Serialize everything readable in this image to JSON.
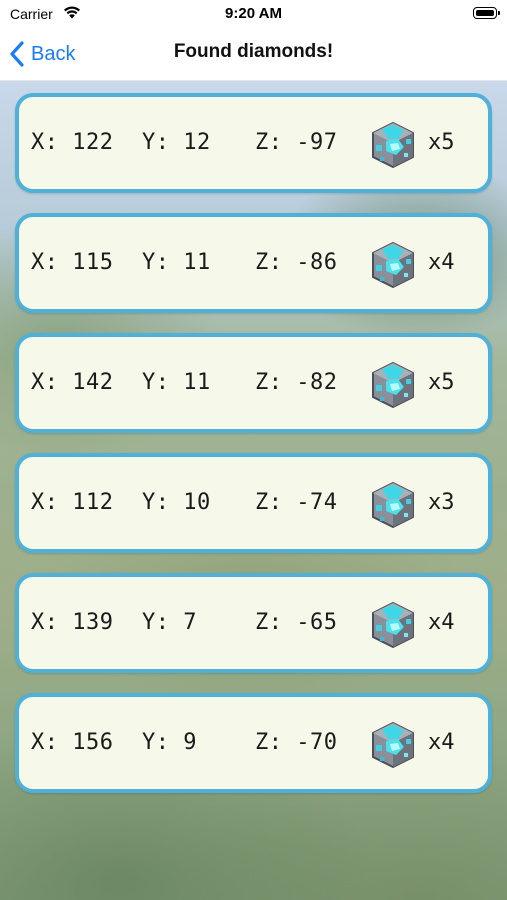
{
  "status_bar": {
    "carrier": "Carrier",
    "time": "9:20 AM"
  },
  "nav": {
    "back_label": "Back",
    "title": "Found diamonds!"
  },
  "icons": {
    "back": "chevron-left-icon",
    "wifi": "wifi-icon",
    "battery": "battery-icon",
    "ore": "diamond-ore-icon"
  },
  "colors": {
    "accent": "#1a7cf5",
    "card_border": "#4fb0d8",
    "card_background": "#f6f9ea"
  },
  "finds": [
    {
      "x": "X: 122",
      "y": "Y: 12",
      "z": "Z: -97",
      "count": "x5"
    },
    {
      "x": "X: 115",
      "y": "Y: 11",
      "z": "Z: -86",
      "count": "x4"
    },
    {
      "x": "X: 142",
      "y": "Y: 11",
      "z": "Z: -82",
      "count": "x5"
    },
    {
      "x": "X: 112",
      "y": "Y: 10",
      "z": "Z: -74",
      "count": "x3"
    },
    {
      "x": "X: 139",
      "y": "Y: 7",
      "z": "Z: -65",
      "count": "x4"
    },
    {
      "x": "X: 156",
      "y": "Y: 9",
      "z": "Z: -70",
      "count": "x4"
    }
  ]
}
